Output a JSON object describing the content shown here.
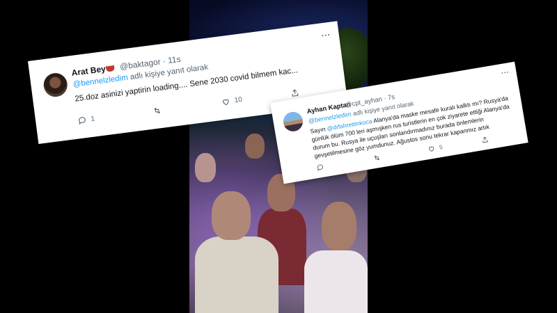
{
  "tweet_1": {
    "name": "Arat Bey",
    "handle": "@baktagor",
    "time": "11s",
    "reply_prefix": "",
    "reply_mention": "@bennelzledim",
    "reply_suffix": " adlı kişiye yanıt olarak",
    "body": "25.doz asinizi yaptirin loading.... Sene 2030 covid bilmem kac...",
    "more": "...",
    "replies": "1",
    "retweets": "",
    "likes": "10",
    "share": ""
  },
  "tweet_2": {
    "name": "Ayhan Kaptan",
    "handle": "@cpt_ayhan",
    "time": "7s",
    "reply_mention": "@bennelzledim",
    "reply_suffix": " adlı kişiye yanıt olarak",
    "body_prefix": "Sayın ",
    "body_mention": "@drfahrettinkoca",
    "body_text": " Alanya'da maske mesafe kuralı kalktı mı? Rusya'da günlük ölüm 700 leri aşmışken rus turistlerin en çok ziyarete ettiği Alanya'da durum bu. Rusya ile uçuşları sonlandırmadınız burada önlemlerin gevşetilmesine göz yumdunuz. Ağustos sonu tekrar kapanmız artık",
    "more": "...",
    "replies": "",
    "retweets": "",
    "likes": "5",
    "share": ""
  },
  "colors": {
    "accent": "#1d9bf0",
    "text": "#0f1419",
    "muted": "#536471",
    "card": "#ffffff",
    "background": "#000000"
  },
  "icons": [
    "reply-icon",
    "retweet-icon",
    "like-icon",
    "share-icon",
    "more-icon"
  ]
}
